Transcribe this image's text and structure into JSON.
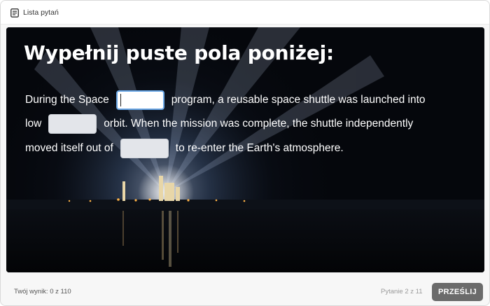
{
  "topbar": {
    "question_list_label": "Lista pytań",
    "question_list_icon": "list-icon"
  },
  "question": {
    "heading": "Wypełnij puste pola poniżej:",
    "line1": {
      "before": "During the Space",
      "after": "program, a reusable space shuttle was launched into"
    },
    "line2": {
      "before": "low",
      "after": "orbit. When the mission was complete, the shuttle independently"
    },
    "line3": {
      "before": "moved itself out of",
      "after": "to re-enter the Earth's atmosphere."
    },
    "blanks": [
      {
        "value": "",
        "focused": true
      },
      {
        "value": "",
        "focused": false
      },
      {
        "value": "",
        "focused": false
      }
    ]
  },
  "footer": {
    "score_text": "Twój wynik: 0 z 110",
    "question_counter": "Pytanie 2 z 11",
    "submit_label": "PRZEŚLIJ"
  },
  "colors": {
    "stage_bg": "#05070c",
    "submit_bg": "#6b6b6b",
    "focus_border": "#6aa7e6"
  }
}
